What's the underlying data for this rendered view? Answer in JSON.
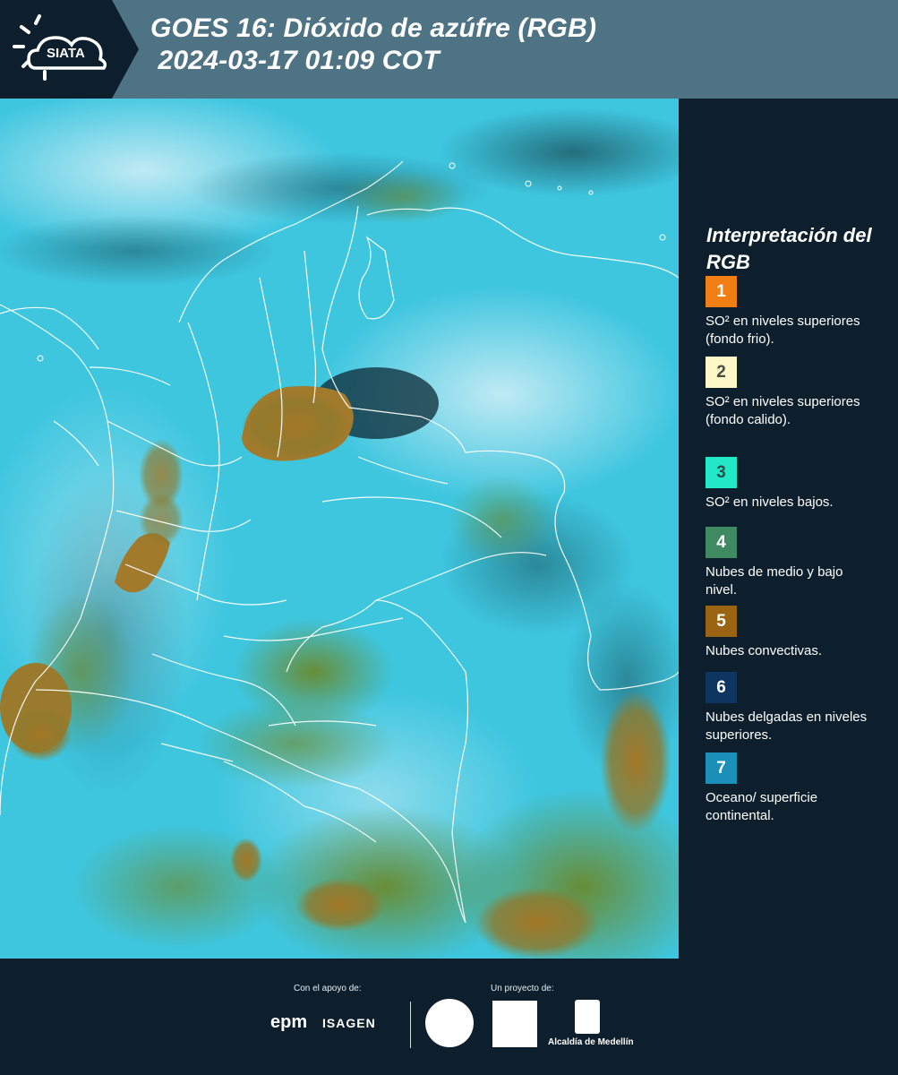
{
  "header": {
    "logo_text": "SIATA",
    "title_line1": "GOES 16: Dióxido de azúfre (RGB)",
    "title_line2": " 2024-03-17 01:09 COT"
  },
  "legend": {
    "title": "Interpretación del RGB",
    "items": [
      {
        "number": "1",
        "label": "SO² en niveles superiores (fondo frio).",
        "color": "#f07e12",
        "text_color": "#ffffff"
      },
      {
        "number": "2",
        "label": "SO² en niveles superiores (fondo calido).",
        "color": "#fdf6c6",
        "text_color": "#4a4a4a"
      },
      {
        "number": "3",
        "label": "SO² en niveles bajos.",
        "color": "#22e8c8",
        "text_color": "#2a4a4a"
      },
      {
        "number": "4",
        "label": "Nubes de medio y bajo nivel.",
        "color": "#3f8a62",
        "text_color": "#ffffff"
      },
      {
        "number": "5",
        "label": "Nubes convectivas.",
        "color": "#9a6412",
        "text_color": "#ffffff"
      },
      {
        "number": "6",
        "label": "Nubes delgadas en niveles superiores.",
        "color": "#0e3560",
        "text_color": "#ffffff"
      },
      {
        "number": "7",
        "label": "Oceano/ superficie continental.",
        "color": "#1a8fb8",
        "text_color": "#ffffff"
      }
    ]
  },
  "footer": {
    "support_label": "Con el apoyo de:",
    "project_label": "Un proyecto de:",
    "sponsors": [
      "epm",
      "ISAGEN"
    ],
    "partners": [
      "Alcaldía de Medellín"
    ]
  },
  "map": {
    "background_color": "#35c8e0",
    "convective_color": "#a67a2a",
    "low_cloud_color": "#4a8a3a",
    "border_color": "#ffffff"
  }
}
